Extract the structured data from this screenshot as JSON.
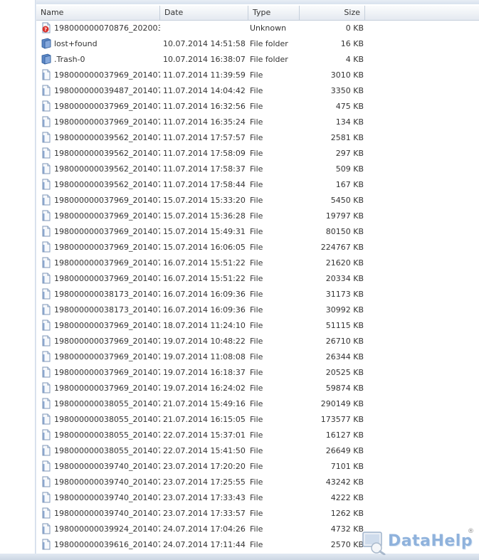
{
  "columns": {
    "name": "Name",
    "date": "Date",
    "type": "Type",
    "size": "Size"
  },
  "rows": [
    {
      "name": "198000000070876_202003...",
      "date": "",
      "type": "Unknown",
      "size": "0 KB",
      "icon": "unknown-file-icon"
    },
    {
      "name": "lost+found",
      "date": "10.07.2014 14:51:58",
      "type": "File folder",
      "size": "16 KB",
      "icon": "folder-icon"
    },
    {
      "name": ".Trash-0",
      "date": "10.07.2014 16:38:07",
      "type": "File folder",
      "size": "4 KB",
      "icon": "folder-icon"
    },
    {
      "name": "198000000037969_201407...",
      "date": "11.07.2014 11:39:59",
      "type": "File",
      "size": "3010 KB",
      "icon": "file-icon"
    },
    {
      "name": "198000000039487_201407...",
      "date": "11.07.2014 14:04:42",
      "type": "File",
      "size": "3350 KB",
      "icon": "file-icon"
    },
    {
      "name": "198000000037969_201407...",
      "date": "11.07.2014 16:32:56",
      "type": "File",
      "size": "475 KB",
      "icon": "file-icon"
    },
    {
      "name": "198000000037969_201407...",
      "date": "11.07.2014 16:35:24",
      "type": "File",
      "size": "134 KB",
      "icon": "file-icon"
    },
    {
      "name": "198000000039562_201407...",
      "date": "11.07.2014 17:57:57",
      "type": "File",
      "size": "2581 KB",
      "icon": "file-icon"
    },
    {
      "name": "198000000039562_201407...",
      "date": "11.07.2014 17:58:09",
      "type": "File",
      "size": "297 KB",
      "icon": "file-icon"
    },
    {
      "name": "198000000039562_201407...",
      "date": "11.07.2014 17:58:37",
      "type": "File",
      "size": "509 KB",
      "icon": "file-icon"
    },
    {
      "name": "198000000039562_201407...",
      "date": "11.07.2014 17:58:44",
      "type": "File",
      "size": "167 KB",
      "icon": "file-icon"
    },
    {
      "name": "198000000037969_201407...",
      "date": "15.07.2014 15:33:20",
      "type": "File",
      "size": "5450 KB",
      "icon": "file-icon"
    },
    {
      "name": "198000000037969_201407...",
      "date": "15.07.2014 15:36:28",
      "type": "File",
      "size": "19797 KB",
      "icon": "file-icon"
    },
    {
      "name": "198000000037969_201407...",
      "date": "15.07.2014 15:49:31",
      "type": "File",
      "size": "80150 KB",
      "icon": "file-icon"
    },
    {
      "name": "198000000037969_201407...",
      "date": "15.07.2014 16:06:05",
      "type": "File",
      "size": "224767 KB",
      "icon": "file-icon"
    },
    {
      "name": "198000000037969_201407...",
      "date": "16.07.2014 15:51:22",
      "type": "File",
      "size": "21620 KB",
      "icon": "file-icon"
    },
    {
      "name": "198000000037969_201407...",
      "date": "16.07.2014 15:51:22",
      "type": "File",
      "size": "20334 KB",
      "icon": "file-icon"
    },
    {
      "name": "198000000038173_201407...",
      "date": "16.07.2014 16:09:36",
      "type": "File",
      "size": "31173 KB",
      "icon": "file-icon"
    },
    {
      "name": "198000000038173_201407...",
      "date": "16.07.2014 16:09:36",
      "type": "File",
      "size": "30992 KB",
      "icon": "file-icon"
    },
    {
      "name": "198000000037969_201407...",
      "date": "18.07.2014 11:24:10",
      "type": "File",
      "size": "51115 KB",
      "icon": "file-icon"
    },
    {
      "name": "198000000037969_201407...",
      "date": "19.07.2014 10:48:22",
      "type": "File",
      "size": "26710 KB",
      "icon": "file-icon"
    },
    {
      "name": "198000000037969_201407...",
      "date": "19.07.2014 11:08:08",
      "type": "File",
      "size": "26344 KB",
      "icon": "file-icon"
    },
    {
      "name": "198000000037969_201407...",
      "date": "19.07.2014 16:18:37",
      "type": "File",
      "size": "20525 KB",
      "icon": "file-icon"
    },
    {
      "name": "198000000037969_201407...",
      "date": "19.07.2014 16:24:02",
      "type": "File",
      "size": "59874 KB",
      "icon": "file-icon"
    },
    {
      "name": "198000000038055_201407...",
      "date": "21.07.2014 15:49:16",
      "type": "File",
      "size": "290149 KB",
      "icon": "file-icon"
    },
    {
      "name": "198000000038055_201407...",
      "date": "21.07.2014 16:15:05",
      "type": "File",
      "size": "173577 KB",
      "icon": "file-icon"
    },
    {
      "name": "198000000038055_201407...",
      "date": "22.07.2014 15:37:01",
      "type": "File",
      "size": "16127 KB",
      "icon": "file-icon"
    },
    {
      "name": "198000000038055_201407...",
      "date": "22.07.2014 15:41:50",
      "type": "File",
      "size": "26649 KB",
      "icon": "file-icon"
    },
    {
      "name": "198000000039740_201407...",
      "date": "23.07.2014 17:20:20",
      "type": "File",
      "size": "7101 KB",
      "icon": "file-icon"
    },
    {
      "name": "198000000039740_201407...",
      "date": "23.07.2014 17:25:55",
      "type": "File",
      "size": "43242 KB",
      "icon": "file-icon"
    },
    {
      "name": "198000000039740_201407...",
      "date": "23.07.2014 17:33:43",
      "type": "File",
      "size": "4222 KB",
      "icon": "file-icon"
    },
    {
      "name": "198000000039740_201407...",
      "date": "23.07.2014 17:33:57",
      "type": "File",
      "size": "1262 KB",
      "icon": "file-icon"
    },
    {
      "name": "198000000039924_201407...",
      "date": "24.07.2014 17:04:26",
      "type": "File",
      "size": "4732 KB",
      "icon": "file-icon"
    },
    {
      "name": "198000000039616_201407...",
      "date": "24.07.2014 17:11:44",
      "type": "File",
      "size": "2570 KB",
      "icon": "file-icon"
    }
  ],
  "watermark": {
    "text": "DataHelp",
    "registered": "®"
  },
  "colors": {
    "header_border": "#c5cfdb",
    "folder_blue": "#5b86c5",
    "unknown_red": "#d9302b",
    "watermark": "#8fb2dc"
  }
}
